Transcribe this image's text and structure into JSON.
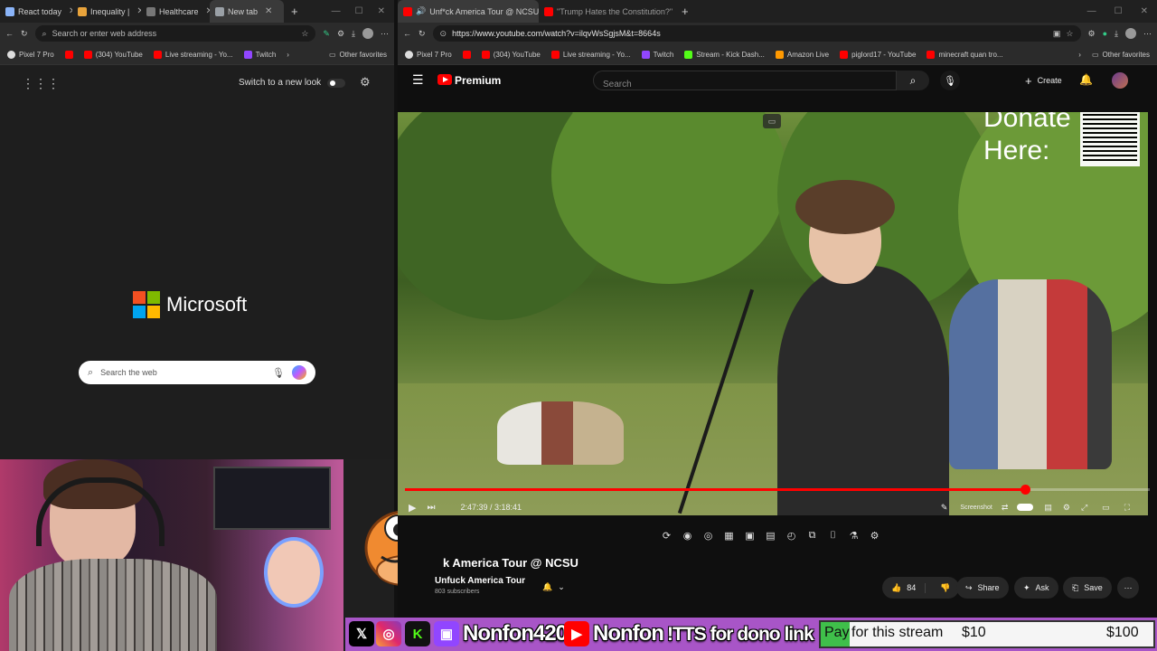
{
  "left_browser": {
    "tabs": [
      {
        "label": "React today",
        "color": "#8ab4f8"
      },
      {
        "label": "Inequality |",
        "color": "#e8a33b"
      },
      {
        "label": "Healthcare",
        "color": "#777777"
      },
      {
        "label": "New tab",
        "color": "#9aa0a6"
      }
    ],
    "address_placeholder": "Search or enter web address",
    "bookmarks": [
      {
        "label": "Pixel 7 Pro",
        "color": "#dddddd"
      },
      {
        "label": "",
        "color": "#ff0000"
      },
      {
        "label": "(304) YouTube",
        "color": "#ff0000"
      },
      {
        "label": "Live streaming - Yo...",
        "color": "#ff0000"
      },
      {
        "label": "Twitch",
        "color": "#9146ff"
      }
    ],
    "other_favorites": "Other favorites",
    "switch_look_label": "Switch to a new look",
    "microsoft_label": "Microsoft",
    "search_placeholder": "Search the web"
  },
  "right_browser": {
    "tabs": [
      {
        "label": "Unf*ck America Tour @ NCSU",
        "color": "#ff0000"
      },
      {
        "label": "\"Trump Hates the Constitution?\"",
        "color": "#ff0000"
      }
    ],
    "url": "https://www.youtube.com/watch?v=ilqvWsSgjsM&t=8664s",
    "bookmarks": [
      {
        "label": "Pixel 7 Pro",
        "color": "#dddddd"
      },
      {
        "label": "",
        "color": "#ff0000"
      },
      {
        "label": "(304) YouTube",
        "color": "#ff0000"
      },
      {
        "label": "Live streaming - Yo...",
        "color": "#ff0000"
      },
      {
        "label": "Twitch",
        "color": "#9146ff"
      },
      {
        "label": "Stream - Kick Dash...",
        "color": "#53fc18"
      },
      {
        "label": "Amazon Live",
        "color": "#ff9900"
      },
      {
        "label": "piglord17 - YouTube",
        "color": "#ff0000"
      },
      {
        "label": "minecraft quan tro...",
        "color": "#ff0000"
      }
    ],
    "other_favorites": "Other favorites"
  },
  "youtube": {
    "logo_text": "Premium",
    "search_placeholder": "Search",
    "create_label": "Create",
    "donate_text_1": "Donate",
    "donate_text_2": "Here:",
    "time_current": "2:47:39",
    "time_total": "3:18:41",
    "progress_fraction": 0.833,
    "screenshot_label": "Screenshot",
    "video_title": "k America Tour @ NCSU",
    "channel_name": "Unfuck America Tour",
    "subscribers": "803 subscribers",
    "likes": "84",
    "share_label": "Share",
    "ask_label": "Ask",
    "save_label": "Save",
    "accent_color": "#ff0000"
  },
  "stream_bar": {
    "username_1": "Nonfon420",
    "username_2": "Nonfon",
    "tts_text": "!TTS for dono link",
    "pay_word": "Pay",
    "pay_text": "for this stream",
    "amount_1": "$10",
    "amount_2": "$100"
  }
}
